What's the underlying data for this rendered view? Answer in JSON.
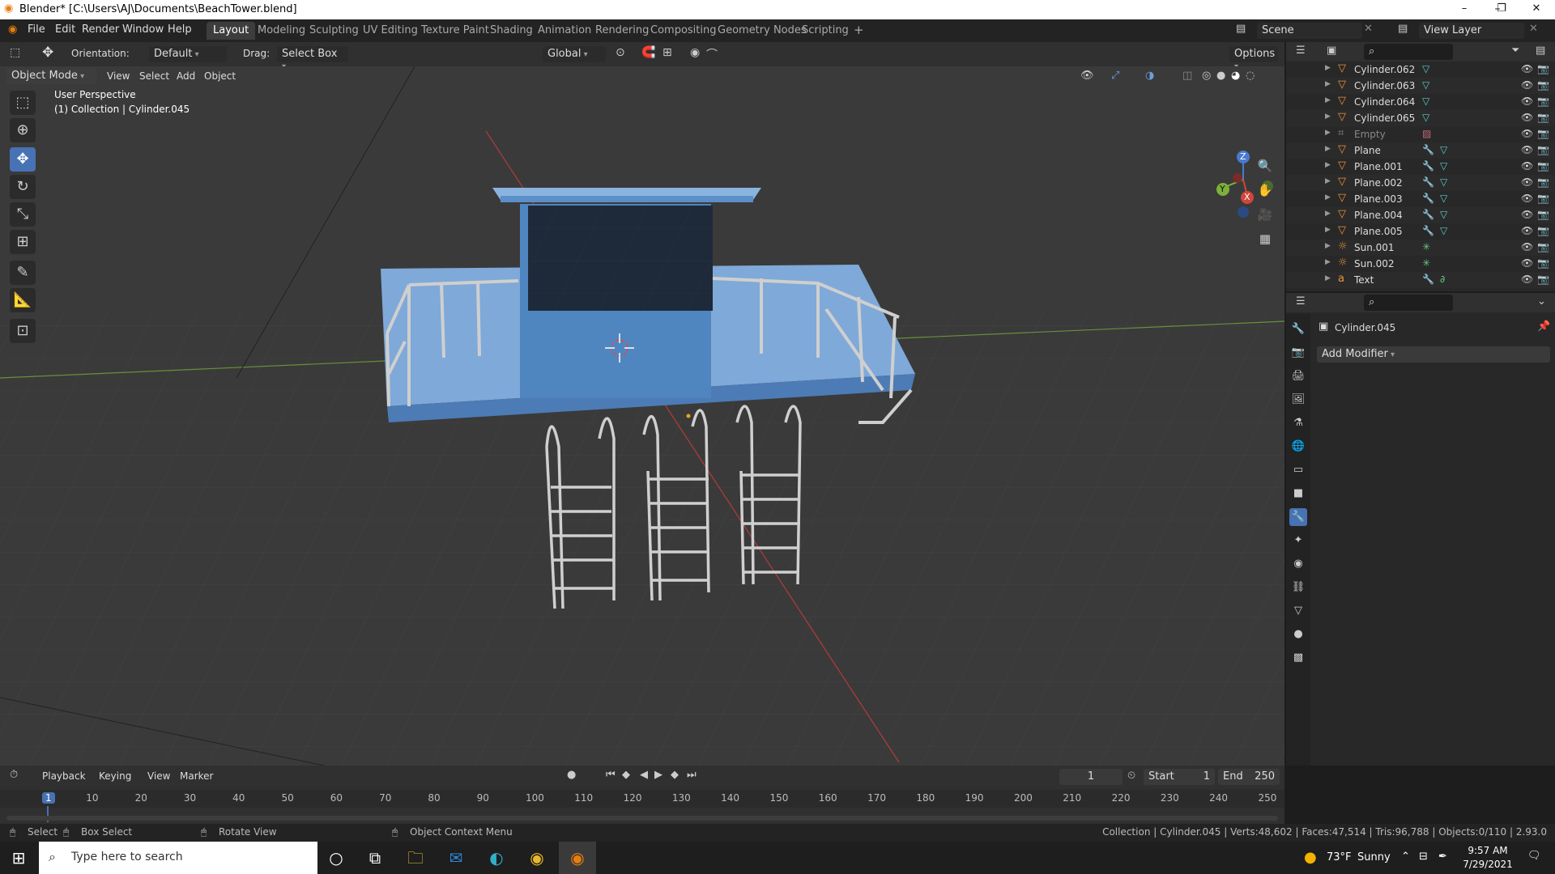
{
  "window": {
    "title": "Blender* [C:\\Users\\AJ\\Documents\\BeachTower.blend]",
    "controls": [
      "–",
      "❐",
      "✕"
    ]
  },
  "menubar": {
    "menus": [
      "File",
      "Edit",
      "Render",
      "Window",
      "Help"
    ],
    "workspaces": [
      "Layout",
      "Modeling",
      "Sculpting",
      "UV Editing",
      "Texture Paint",
      "Shading",
      "Animation",
      "Rendering",
      "Compositing",
      "Geometry Nodes",
      "Scripting"
    ],
    "active_workspace": "Layout",
    "add_tab": "+",
    "scene": "Scene",
    "view_layer": "View Layer"
  },
  "tool_header": {
    "orientation_label": "Orientation:",
    "orientation_value": "Default",
    "drag_label": "Drag:",
    "drag_value": "Select Box",
    "transform_orientation": "Global",
    "options": "Options"
  },
  "viewport_header": {
    "mode": "Object Mode",
    "menus": [
      "View",
      "Select",
      "Add",
      "Object"
    ]
  },
  "viewport": {
    "perspective": "User Perspective",
    "collection_info": "(1) Collection | Cylinder.045",
    "gizmo_axes": [
      "Z",
      "Y",
      "X"
    ]
  },
  "toolbar": {
    "tools": [
      "select-box",
      "cursor",
      "move",
      "rotate",
      "scale",
      "transform",
      "annotate",
      "measure",
      "add-cube"
    ],
    "active_tool": "move"
  },
  "outliner": {
    "items": [
      {
        "name": "Cylinder.062",
        "icon": "mesh-object-icon",
        "extra": [
          "mesh-data-icon"
        ]
      },
      {
        "name": "Cylinder.063",
        "icon": "mesh-object-icon",
        "extra": [
          "mesh-data-icon"
        ]
      },
      {
        "name": "Cylinder.064",
        "icon": "mesh-object-icon",
        "extra": [
          "mesh-data-icon"
        ]
      },
      {
        "name": "Cylinder.065",
        "icon": "mesh-object-icon",
        "extra": [
          "mesh-data-icon"
        ]
      },
      {
        "name": "Empty",
        "icon": "empty-object-icon",
        "extra": [
          "image-icon"
        ],
        "disabled": true
      },
      {
        "name": "Plane",
        "icon": "mesh-object-icon",
        "extra": [
          "modifier-icon",
          "mesh-data-icon"
        ]
      },
      {
        "name": "Plane.001",
        "icon": "mesh-object-icon",
        "extra": [
          "modifier-icon",
          "mesh-data-icon"
        ]
      },
      {
        "name": "Plane.002",
        "icon": "mesh-object-icon",
        "extra": [
          "modifier-icon",
          "mesh-data-icon"
        ]
      },
      {
        "name": "Plane.003",
        "icon": "mesh-object-icon",
        "extra": [
          "modifier-icon",
          "mesh-data-icon"
        ]
      },
      {
        "name": "Plane.004",
        "icon": "mesh-object-icon",
        "extra": [
          "modifier-icon",
          "mesh-data-icon"
        ]
      },
      {
        "name": "Plane.005",
        "icon": "mesh-object-icon",
        "extra": [
          "modifier-icon",
          "mesh-data-icon"
        ]
      },
      {
        "name": "Sun.001",
        "icon": "light-object-icon",
        "extra": [
          "sun-data-icon"
        ]
      },
      {
        "name": "Sun.002",
        "icon": "light-object-icon",
        "extra": [
          "sun-data-icon"
        ]
      },
      {
        "name": "Text",
        "icon": "text-object-icon",
        "extra": [
          "modifier-icon",
          "curve-data-icon"
        ]
      }
    ]
  },
  "properties": {
    "object_name": "Cylinder.045",
    "add_modifier": "Add Modifier",
    "active_tab": "modifier",
    "tabs": [
      "tool",
      "render",
      "output",
      "view-layer",
      "scene",
      "world",
      "collection",
      "object",
      "modifier",
      "particles",
      "physics",
      "constraints",
      "data",
      "material",
      "texture"
    ]
  },
  "timeline": {
    "menus": [
      "Playback",
      "Keying",
      "View",
      "Marker"
    ],
    "current_frame": "1",
    "start_label": "Start",
    "start": "1",
    "end_label": "End",
    "end": "250",
    "ticks": [
      "1",
      "10",
      "20",
      "30",
      "40",
      "50",
      "60",
      "70",
      "80",
      "90",
      "100",
      "110",
      "120",
      "130",
      "140",
      "150",
      "160",
      "170",
      "180",
      "190",
      "200",
      "210",
      "220",
      "230",
      "240",
      "250"
    ]
  },
  "statusbar": {
    "select": "Select",
    "box_select": "Box Select",
    "rotate_view": "Rotate View",
    "context_menu": "Object Context Menu",
    "stats": "Collection | Cylinder.045 | Verts:48,602 | Faces:47,514 | Tris:96,788 | Objects:0/110 | 2.93.0"
  },
  "taskbar": {
    "search_placeholder": "Type here to search",
    "weather_temp": "73°F",
    "weather_cond": "Sunny",
    "time": "9:57 AM",
    "date": "7/29/2021"
  },
  "colors": {
    "accent": "#4772b3",
    "object_orange": "#e8943a",
    "mesh_data_green": "#5fc9a0",
    "model_blue": "#5b8fc7"
  }
}
